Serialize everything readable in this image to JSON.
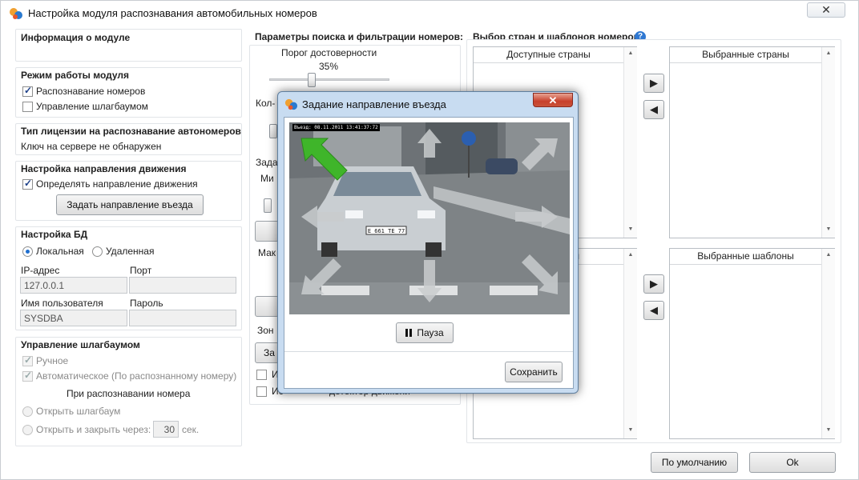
{
  "window": {
    "title": "Настройка модуля распознавания автомобильных номеров",
    "close_label": "✕"
  },
  "module_info": {
    "header": "Информация о модуле"
  },
  "mode": {
    "header": "Режим работы модуля",
    "recognition_label": "Распознавание номеров",
    "recognition_checked": true,
    "barrier_label": "Управление шлагбаумом",
    "barrier_checked": false
  },
  "license": {
    "header": "Тип лицензии на распознавание автономеров",
    "status": "Ключ на сервере не обнаружен"
  },
  "direction": {
    "header": "Настройка направления движения",
    "detect_label": "Определять направление движения",
    "detect_checked": true,
    "set_button": "Задать направление въезда"
  },
  "db": {
    "header": "Настройка БД",
    "local_label": "Локальная",
    "remote_label": "Удаленная",
    "selected": "local",
    "ip_label": "IP-адрес",
    "ip_value": "127.0.0.1",
    "port_label": "Порт",
    "port_value": "",
    "user_label": "Имя пользователя",
    "user_value": "SYSDBA",
    "password_label": "Пароль",
    "password_value": ""
  },
  "barrier": {
    "header": "Управление шлагбаумом",
    "manual_label": "Ручное",
    "auto_label": "Автоматическое (По распознанному номеру)",
    "on_recognition_label": "При распознавании номера",
    "open_label": "Открыть шлагбаум",
    "open_close_label": "Открыть и закрыть через:",
    "seconds_value": "30",
    "seconds_unit": "сек."
  },
  "search": {
    "header": "Параметры поиска и фильтрации номеров:",
    "threshold_label": "Порог достоверности",
    "threshold_value": "35%",
    "threshold_fraction": 0.35,
    "count_label_partial": "Кол-",
    "zone_label_partial": "Зада",
    "min_label_partial": "Ми",
    "max_label_partial": "Мак",
    "zones_label_partial": "Зон",
    "zone_button_partial": "За",
    "check1_partial": "И",
    "check2_partial": "Ис",
    "check2_tail": "детектор движени"
  },
  "countries": {
    "header": "Выбор стран и шаблонов номеров",
    "available_header": "Доступные страны",
    "selected_header": "Выбранные страны",
    "templates_partial": "ны",
    "selected_templates_header": "Выбранные шаблоны",
    "add_icon": "▶",
    "remove_icon": "◀"
  },
  "footer": {
    "default_button": "По умолчанию",
    "ok_button": "Ok"
  },
  "modal": {
    "title": "Задание направление въезда",
    "close_label": "✕",
    "osd_text": "Въезд: 08.11.2011 13:41:37:72",
    "pause_button": "Пауза",
    "save_button": "Сохранить",
    "plate_text": "Е 661 ТЕ 77",
    "selected_direction": "up-left",
    "arrow_color_active": "#3fb52a",
    "arrow_color_inactive": "#c9ccce"
  },
  "colors": {
    "accent": "#1f6fcf",
    "titlebar_modal": "#c8dcf1",
    "close_red": "#c8402c"
  }
}
